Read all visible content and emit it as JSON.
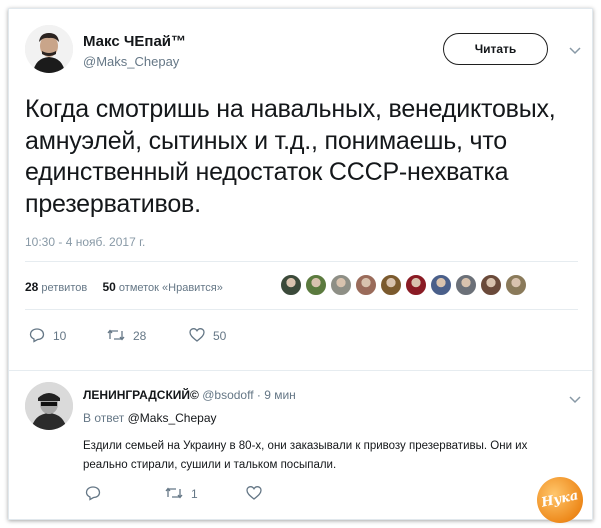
{
  "tweet": {
    "author_name": "Макс ЧЕпай™",
    "author_handle": "@Maks_Chepay",
    "follow_label": "Читать",
    "text": "Когда смотришь на навальных, венедиктовых, амнуэлей, сытиных и т.д., понимаешь, что единственный недостаток СССР-нехватка презервативов.",
    "timestamp": "10:30 - 4 нояб. 2017 г.",
    "retweets_count": "28",
    "retweets_label": "ретвитов",
    "likes_count": "50",
    "likes_label": "отметок «Нравится»",
    "liker_avatars": [
      "#3b4a3a",
      "#5b7a3e",
      "#8e8f86",
      "#9a6b5a",
      "#7b5a2e",
      "#8a1b24",
      "#4a5f8a",
      "#6b7078",
      "#6a4a3a",
      "#8a7a5a"
    ],
    "actions": {
      "reply_count": "10",
      "retweet_count": "28",
      "like_count": "50"
    },
    "icons": [
      "reply-icon",
      "retweet-icon",
      "like-icon",
      "chevron-down-icon"
    ]
  },
  "reply": {
    "author_name": "ЛЕНИНГРАДСКИЙ©",
    "author_handle": "@bsodoff",
    "time": "9 мин",
    "reply_to_label": "В ответ",
    "reply_to_handle": "@Maks_Chepay",
    "text": "Ездили семьей на Украину в 80-х, они заказывали к привозу презервативы. Они их реально стирали, сушили и тальком посыпали.",
    "actions": {
      "retweet_count": "1"
    }
  },
  "watermark": "Нука",
  "colors": {
    "text": "#14171a",
    "muted": "#657786",
    "border": "#e6ecf0",
    "watermark": "#ee8a1c"
  }
}
